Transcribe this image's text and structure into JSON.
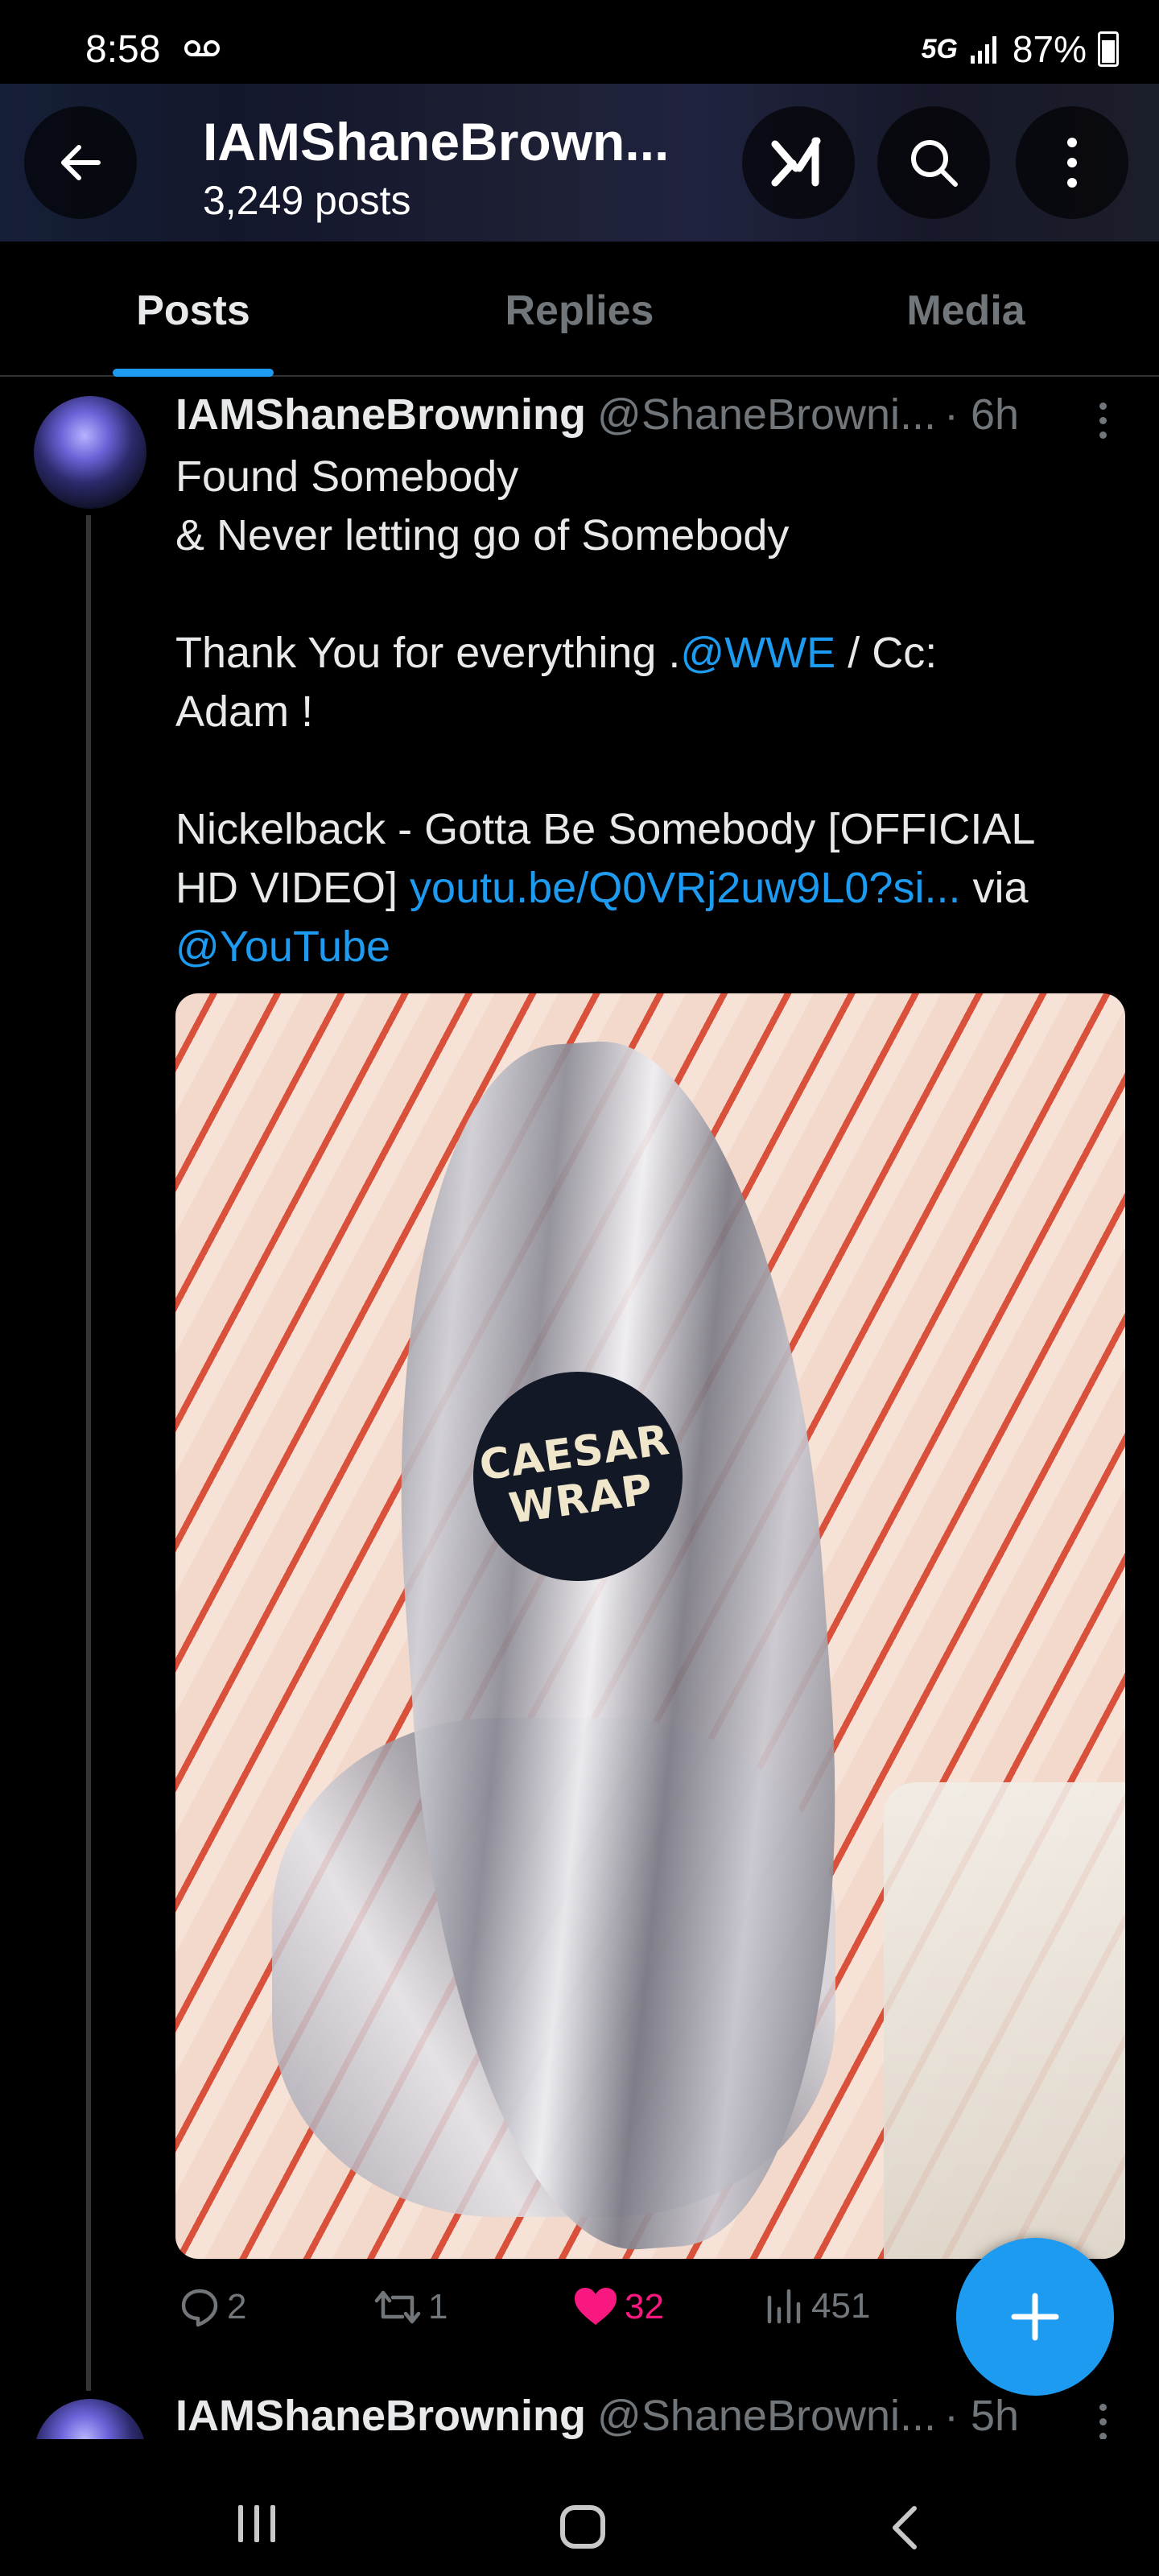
{
  "status_bar": {
    "time": "8:58",
    "network": "5G",
    "battery": "87%"
  },
  "header": {
    "name": "IAMShaneBrown...",
    "posts_count": "3,249 posts"
  },
  "tabs": [
    {
      "label": "Posts",
      "active": true
    },
    {
      "label": "Replies",
      "active": false
    },
    {
      "label": "Media",
      "active": false
    }
  ],
  "tweet": {
    "display_name": "IAMShaneBrowning",
    "handle": "@ShaneBrowni...",
    "time": "· 6h",
    "line1": "Found Somebody",
    "line2": "& Never letting go of Somebody",
    "line3_prefix": "Thank You for everything .",
    "line3_mention": "@WWE",
    "line3_suffix": " / Cc:",
    "line4": "Adam !",
    "line5": "Nickelback - Gotta Be Somebody [OFFICIAL",
    "line6_prefix": "HD VIDEO] ",
    "line6_link": "youtu.be/Q0VRj2uw9L0?si...",
    "line6_suffix": " via",
    "line7_mention": "@YouTube",
    "media_sticker_line1": "CAESAR",
    "media_sticker_line2": "WRAP",
    "replies": "2",
    "reposts": "1",
    "likes": "32",
    "views": "451"
  },
  "next_tweet": {
    "display_name": "IAMShaneBrowning",
    "handle": "@ShaneBrowni...",
    "time": "· 5h"
  },
  "colors": {
    "accent": "#1d9bf0",
    "like": "#f91880",
    "muted": "#71767b",
    "text": "#e7e9ea",
    "background": "#000000"
  },
  "icons": [
    "back-arrow-icon",
    "grok-icon",
    "search-icon",
    "more-vertical-icon",
    "reply-icon",
    "repost-icon",
    "heart-icon",
    "views-icon",
    "plus-icon"
  ]
}
